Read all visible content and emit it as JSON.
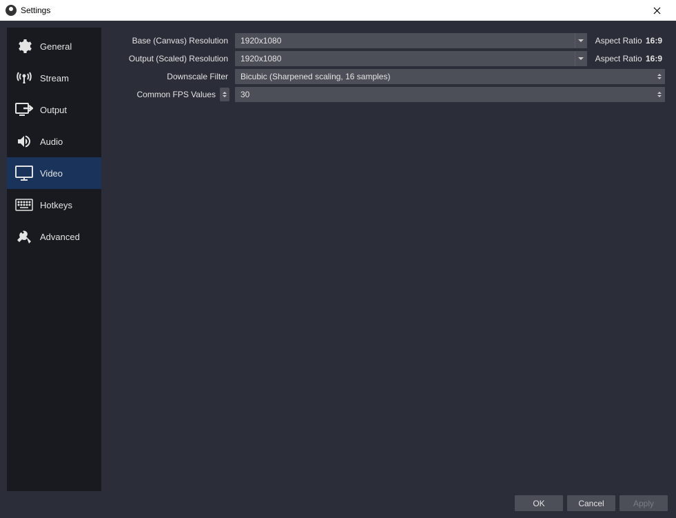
{
  "window": {
    "title": "Settings"
  },
  "sidebar": {
    "items": [
      {
        "label": "General",
        "icon": "gear-icon"
      },
      {
        "label": "Stream",
        "icon": "antenna-icon"
      },
      {
        "label": "Output",
        "icon": "arrow-out-icon"
      },
      {
        "label": "Audio",
        "icon": "speaker-icon"
      },
      {
        "label": "Video",
        "icon": "monitor-icon",
        "active": true
      },
      {
        "label": "Hotkeys",
        "icon": "keyboard-icon"
      },
      {
        "label": "Advanced",
        "icon": "tools-icon"
      }
    ]
  },
  "video": {
    "base_res": {
      "label": "Base (Canvas) Resolution",
      "value": "1920x1080",
      "aspect_label": "Aspect Ratio",
      "aspect_ratio": "16:9"
    },
    "output_res": {
      "label": "Output (Scaled) Resolution",
      "value": "1920x1080",
      "aspect_label": "Aspect Ratio",
      "aspect_ratio": "16:9"
    },
    "downscale": {
      "label": "Downscale Filter",
      "value": "Bicubic (Sharpened scaling, 16 samples)"
    },
    "fps": {
      "label": "Common FPS Values",
      "value": "30"
    }
  },
  "footer": {
    "ok": "OK",
    "cancel": "Cancel",
    "apply": "Apply"
  }
}
